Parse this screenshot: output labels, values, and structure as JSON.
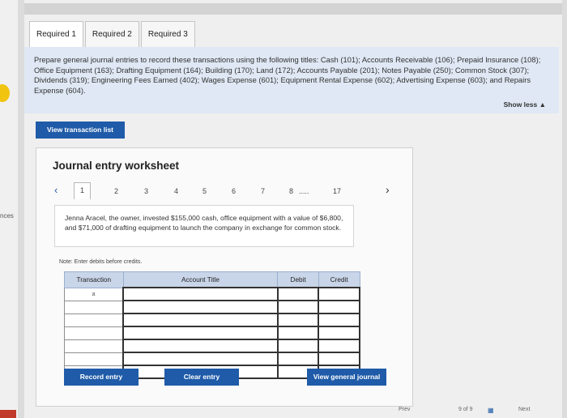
{
  "tabs": [
    {
      "label": "Required 1"
    },
    {
      "label": "Required 2"
    },
    {
      "label": "Required 3"
    }
  ],
  "instructions": "Prepare general journal entries to record these transactions using the following titles: Cash (101); Accounts Receivable (106); Prepaid Insurance (108); Office Equipment (163); Drafting Equipment (164); Building (170); Land (172); Accounts Payable (201); Notes Payable (250); Common Stock (307); Dividends (319); Engineering Fees Earned (402); Wages Expense (601); Equipment Rental Expense (602); Advertising Expense (603); and Repairs Expense (604).",
  "show_less": "Show less ▲",
  "view_transaction_list": "View transaction list",
  "worksheet": {
    "title": "Journal entry worksheet",
    "nav": [
      "1",
      "2",
      "3",
      "4",
      "5",
      "6",
      "7",
      "8",
      ".....",
      "17"
    ],
    "description": "Jenna Aracel, the owner, invested $155,000 cash, office equipment with a value of $6,800, and $71,000 of drafting equipment to launch the company in exchange for common stock.",
    "note": "Note: Enter debits before credits.",
    "columns": [
      "Transaction",
      "Account Title",
      "Debit",
      "Credit"
    ],
    "first_row_transaction": "a",
    "record_entry": "Record entry",
    "clear_entry": "Clear entry",
    "view_general_journal": "View general journal"
  },
  "side_label": "nces",
  "footer": {
    "prev": "Prev",
    "page": "9 of 9",
    "next": "Next"
  }
}
